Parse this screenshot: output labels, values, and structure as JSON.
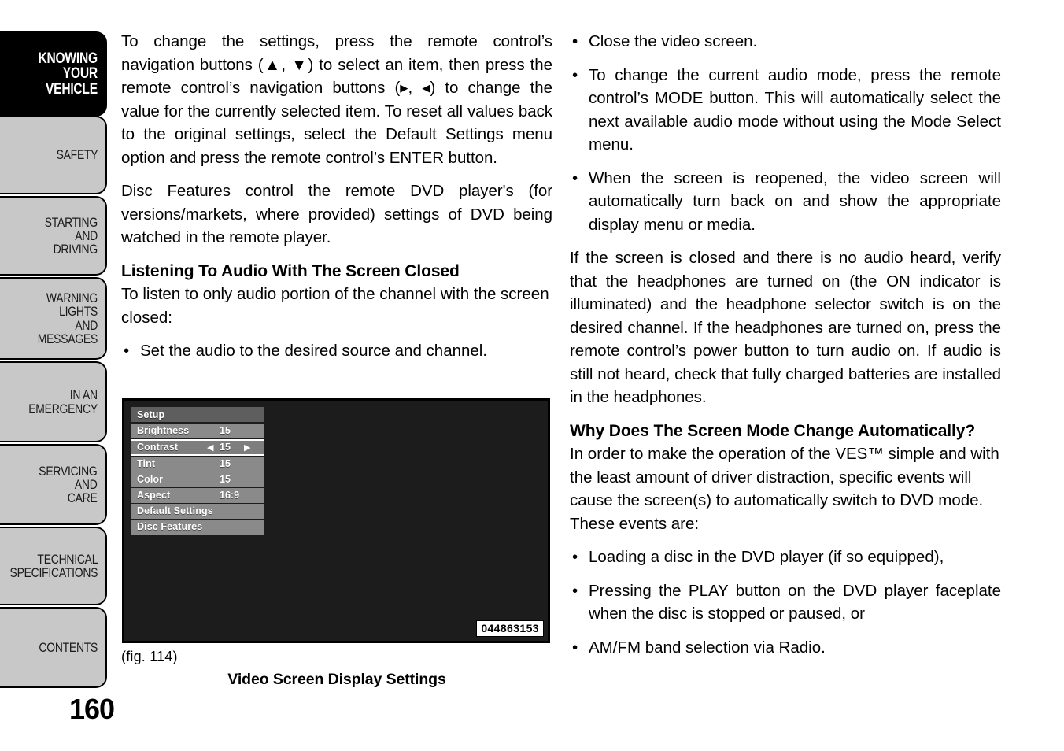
{
  "document": {
    "page_number": "160"
  },
  "sidebar": {
    "tabs": [
      {
        "label": "KNOWING\nYOUR\nVEHICLE",
        "active": true,
        "name": "sidebar-tab-knowing-your-vehicle"
      },
      {
        "label": "SAFETY",
        "active": false,
        "name": "sidebar-tab-safety"
      },
      {
        "label": "STARTING\nAND\nDRIVING",
        "active": false,
        "name": "sidebar-tab-starting-and-driving"
      },
      {
        "label": "WARNING\nLIGHTS\nAND\nMESSAGES",
        "active": false,
        "name": "sidebar-tab-warning-lights-and-messages"
      },
      {
        "label": "IN AN\nEMERGENCY",
        "active": false,
        "name": "sidebar-tab-in-an-emergency"
      },
      {
        "label": "SERVICING\nAND\nCARE",
        "active": false,
        "name": "sidebar-tab-servicing-and-care"
      },
      {
        "label": "TECHNICAL\nSPECIFICATIONS",
        "active": false,
        "name": "sidebar-tab-technical-specifications"
      },
      {
        "label": "CONTENTS",
        "active": false,
        "name": "sidebar-tab-contents"
      }
    ]
  },
  "left_column": {
    "paragraph_1": "To change the settings, press the remote control’s navigation buttons (▲, ▼) to select an item, then press the remote control’s navigation buttons (▸, ◂) to change the value for the currently selected item. To reset all values back to the original settings, select the Default Settings menu option and press the remote control’s ENTER button.",
    "paragraph_2": "Disc Features control the remote DVD player's (for versions/markets, where provided) settings of DVD being watched in the remote player.",
    "heading_1": "Listening To Audio With The Screen Closed",
    "paragraph_3": "To listen to only audio portion of the channel with the screen closed:",
    "bullets": [
      "Set the audio to the desired source and channel."
    ]
  },
  "right_column": {
    "bullets_1": [
      "Close the video screen.",
      "To change the current audio mode, press the remote control’s MODE button. This will automatically select the next available audio mode without using the Mode Select menu.",
      "When the screen is reopened, the video screen will automatically turn back on and show the appropriate display menu or media."
    ],
    "paragraph_1": "If the screen is closed and there is no audio heard, verify that the headphones are turned on (the ON indicator is illuminated) and the headphone selector switch is on the desired channel. If the headphones are turned on, press the remote control’s power button to turn audio on. If audio is still not heard, check that fully charged batteries are installed in the headphones.",
    "heading_1": "Why Does The Screen Mode Change Automatically?",
    "paragraph_2": "In order to make the operation of the VES™ simple and with the least amount of driver distraction, specific events will cause the screen(s) to automatically switch to DVD mode. These events are:",
    "bullets_2": [
      "Loading a disc in the DVD player (if so equipped),",
      "Pressing the PLAY button on the DVD player faceplate when the disc is stopped or paused, or",
      "AM/FM band selection via Radio."
    ]
  },
  "figure": {
    "reference": "(fig. 114)",
    "caption": "Video Screen Display Settings",
    "image_code": "044863153",
    "menu": {
      "title": "Setup",
      "rows": [
        {
          "label": "Brightness",
          "value": "15",
          "selected": false,
          "has_arrows": false
        },
        {
          "label": "Contrast",
          "value": "15",
          "selected": true,
          "has_arrows": true
        },
        {
          "label": "Tint",
          "value": "15",
          "selected": false,
          "has_arrows": false
        },
        {
          "label": "Color",
          "value": "15",
          "selected": false,
          "has_arrows": false
        },
        {
          "label": "Aspect",
          "value": "16:9",
          "selected": false,
          "has_arrows": false
        },
        {
          "label": "Default Settings",
          "value": "",
          "selected": false,
          "has_arrows": false
        },
        {
          "label": "Disc Features",
          "value": "",
          "selected": false,
          "has_arrows": false
        }
      ],
      "arrow_left": "◀",
      "arrow_right": "▶"
    }
  }
}
